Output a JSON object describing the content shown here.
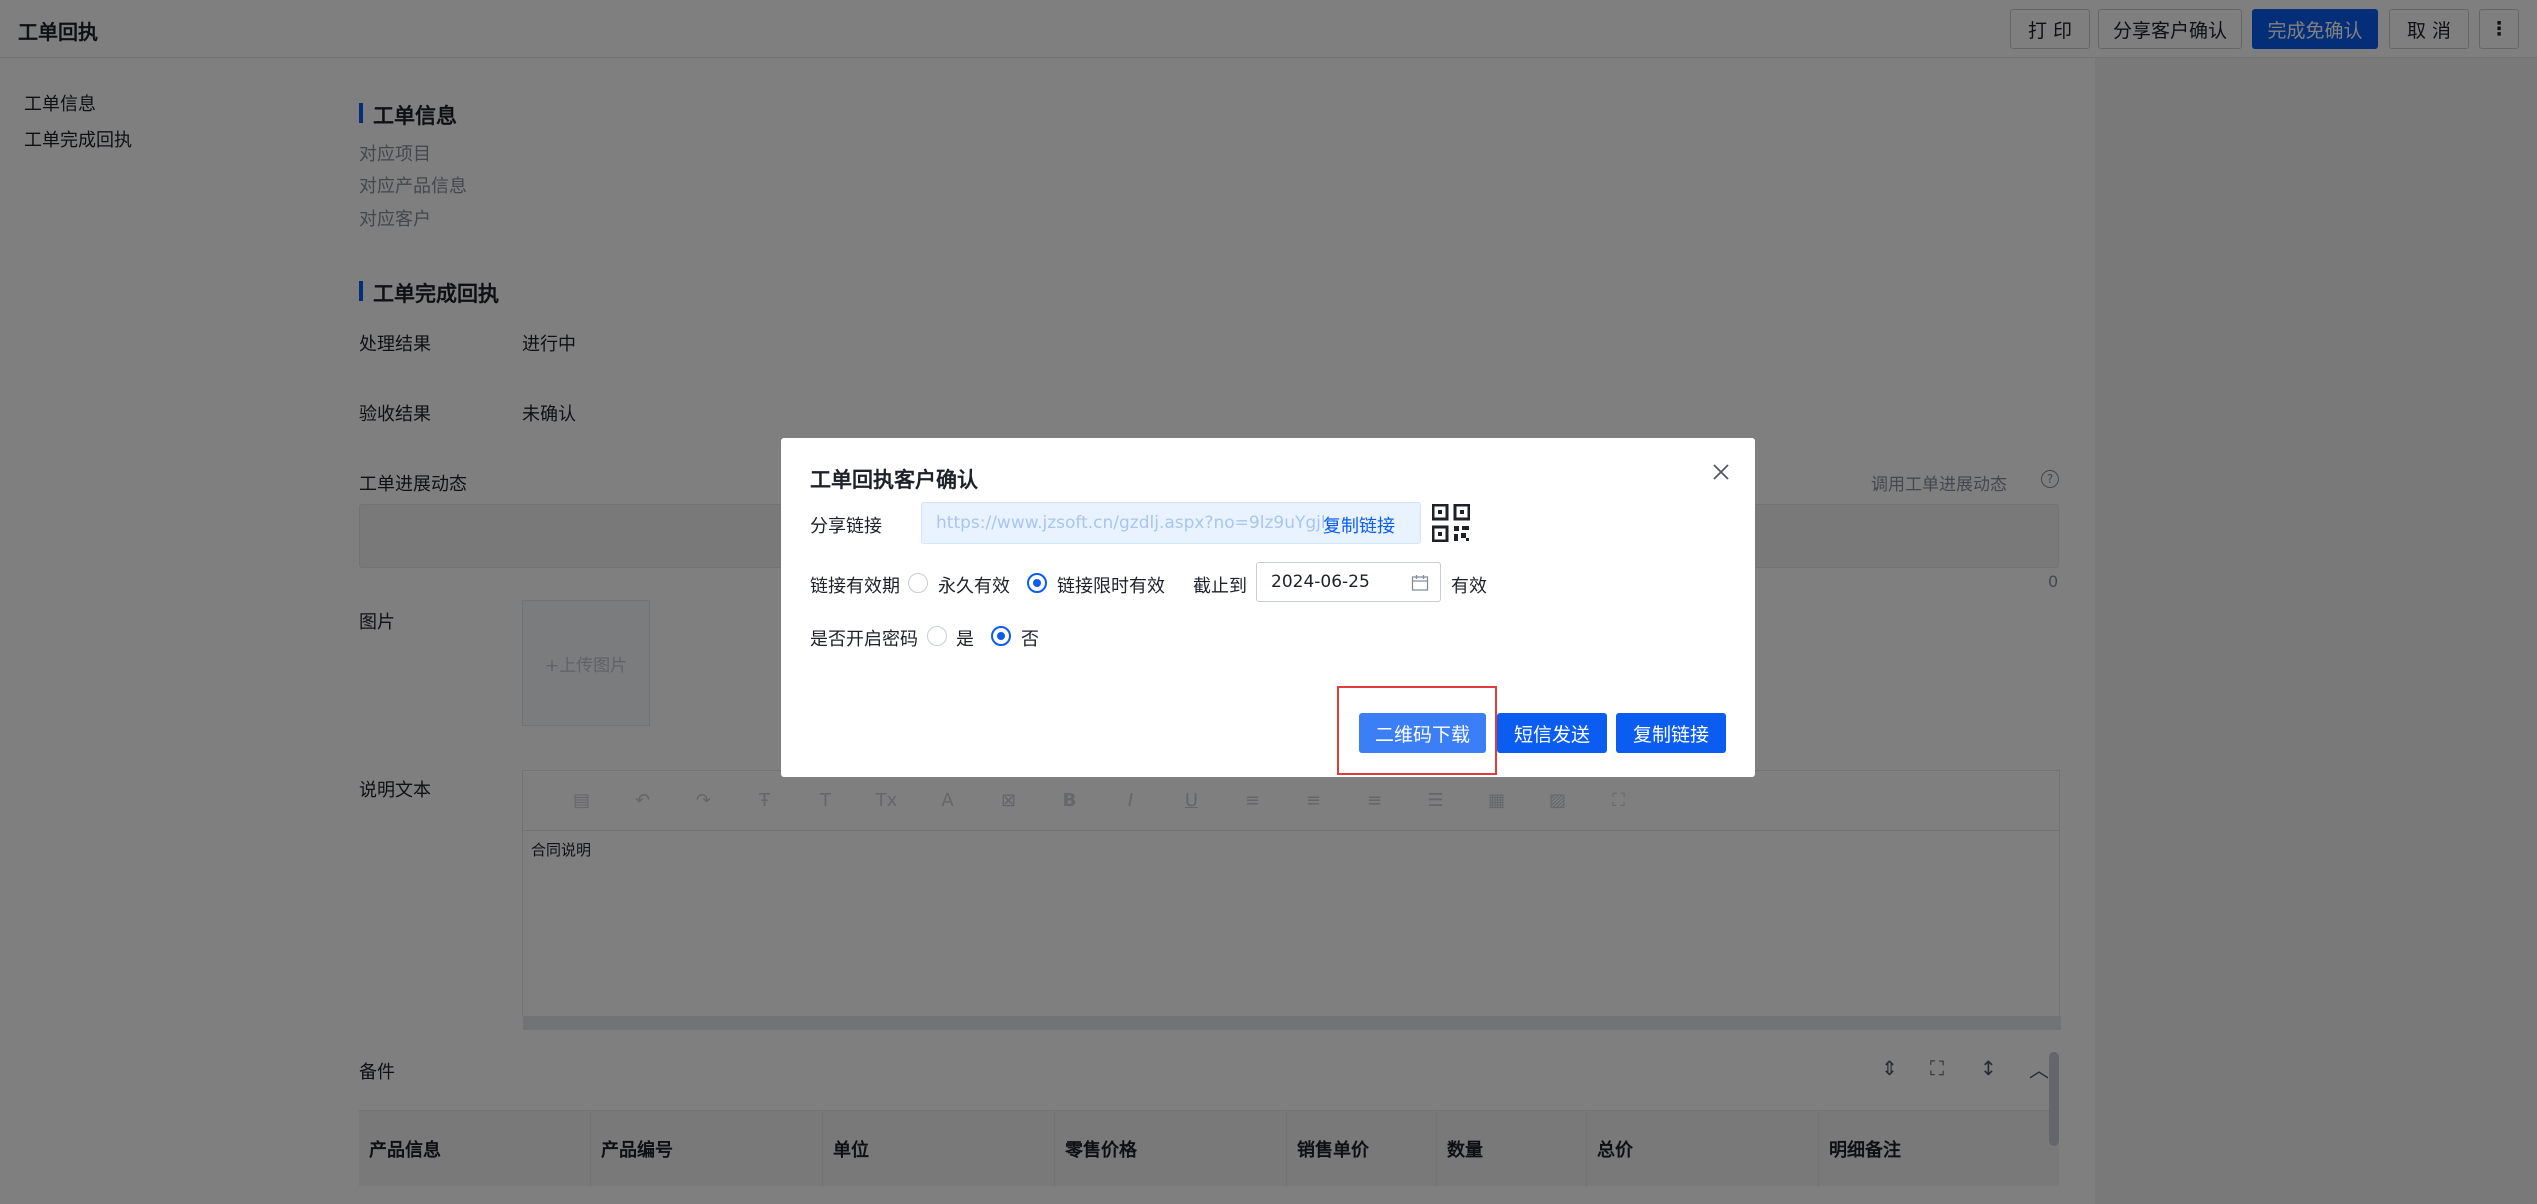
{
  "header": {
    "title": "工单回执",
    "buttons": {
      "print": "打 印",
      "share": "分享客户确认",
      "complete": "完成免确认",
      "cancel": "取 消",
      "more": "⋮"
    }
  },
  "leftnav": {
    "items": [
      "工单信息",
      "工单完成回执"
    ]
  },
  "main": {
    "section1": {
      "title": "工单信息",
      "items": [
        "对应项目",
        "对应产品信息",
        "对应客户"
      ]
    },
    "section2": {
      "title": "工单完成回执",
      "result_label": "处理结果",
      "result_value": "进行中",
      "accept_label": "验收结果",
      "accept_value": "未确认",
      "progress_label": "工单进展动态",
      "progress_link": "调用工单进展动态",
      "progress_count": "0",
      "image_label": "图片",
      "upload_text": "+上传图片",
      "desc_label": "说明文本",
      "desc_content": "合同说明",
      "notes_label": "备件"
    },
    "table": {
      "columns": [
        "产品信息",
        "产品编号",
        "单位",
        "零售价格",
        "销售单价",
        "数量",
        "总价",
        "明细备注"
      ]
    }
  },
  "modal": {
    "title": "工单回执客户确认",
    "share_label": "分享链接",
    "share_url": "https://www.jzsoft.cn/gzdlj.aspx?no=9lz9uYgjlq",
    "copy_link_inline": "复制链接",
    "validity_label": "链接有效期",
    "validity_options": [
      "永久有效",
      "链接限时有效"
    ],
    "validity_selected": "链接限时有效",
    "until_label": "截止到",
    "until_date": "2024-06-25",
    "valid_suffix": "有效",
    "password_label": "是否开启密码",
    "password_options": [
      "是",
      "否"
    ],
    "password_selected": "否",
    "buttons": {
      "qr_download": "二维码下载",
      "sms_send": "短信发送",
      "copy_link": "复制链接"
    }
  },
  "colors": {
    "primary": "#0b5cf0",
    "highlight_border": "#e23b3b"
  }
}
